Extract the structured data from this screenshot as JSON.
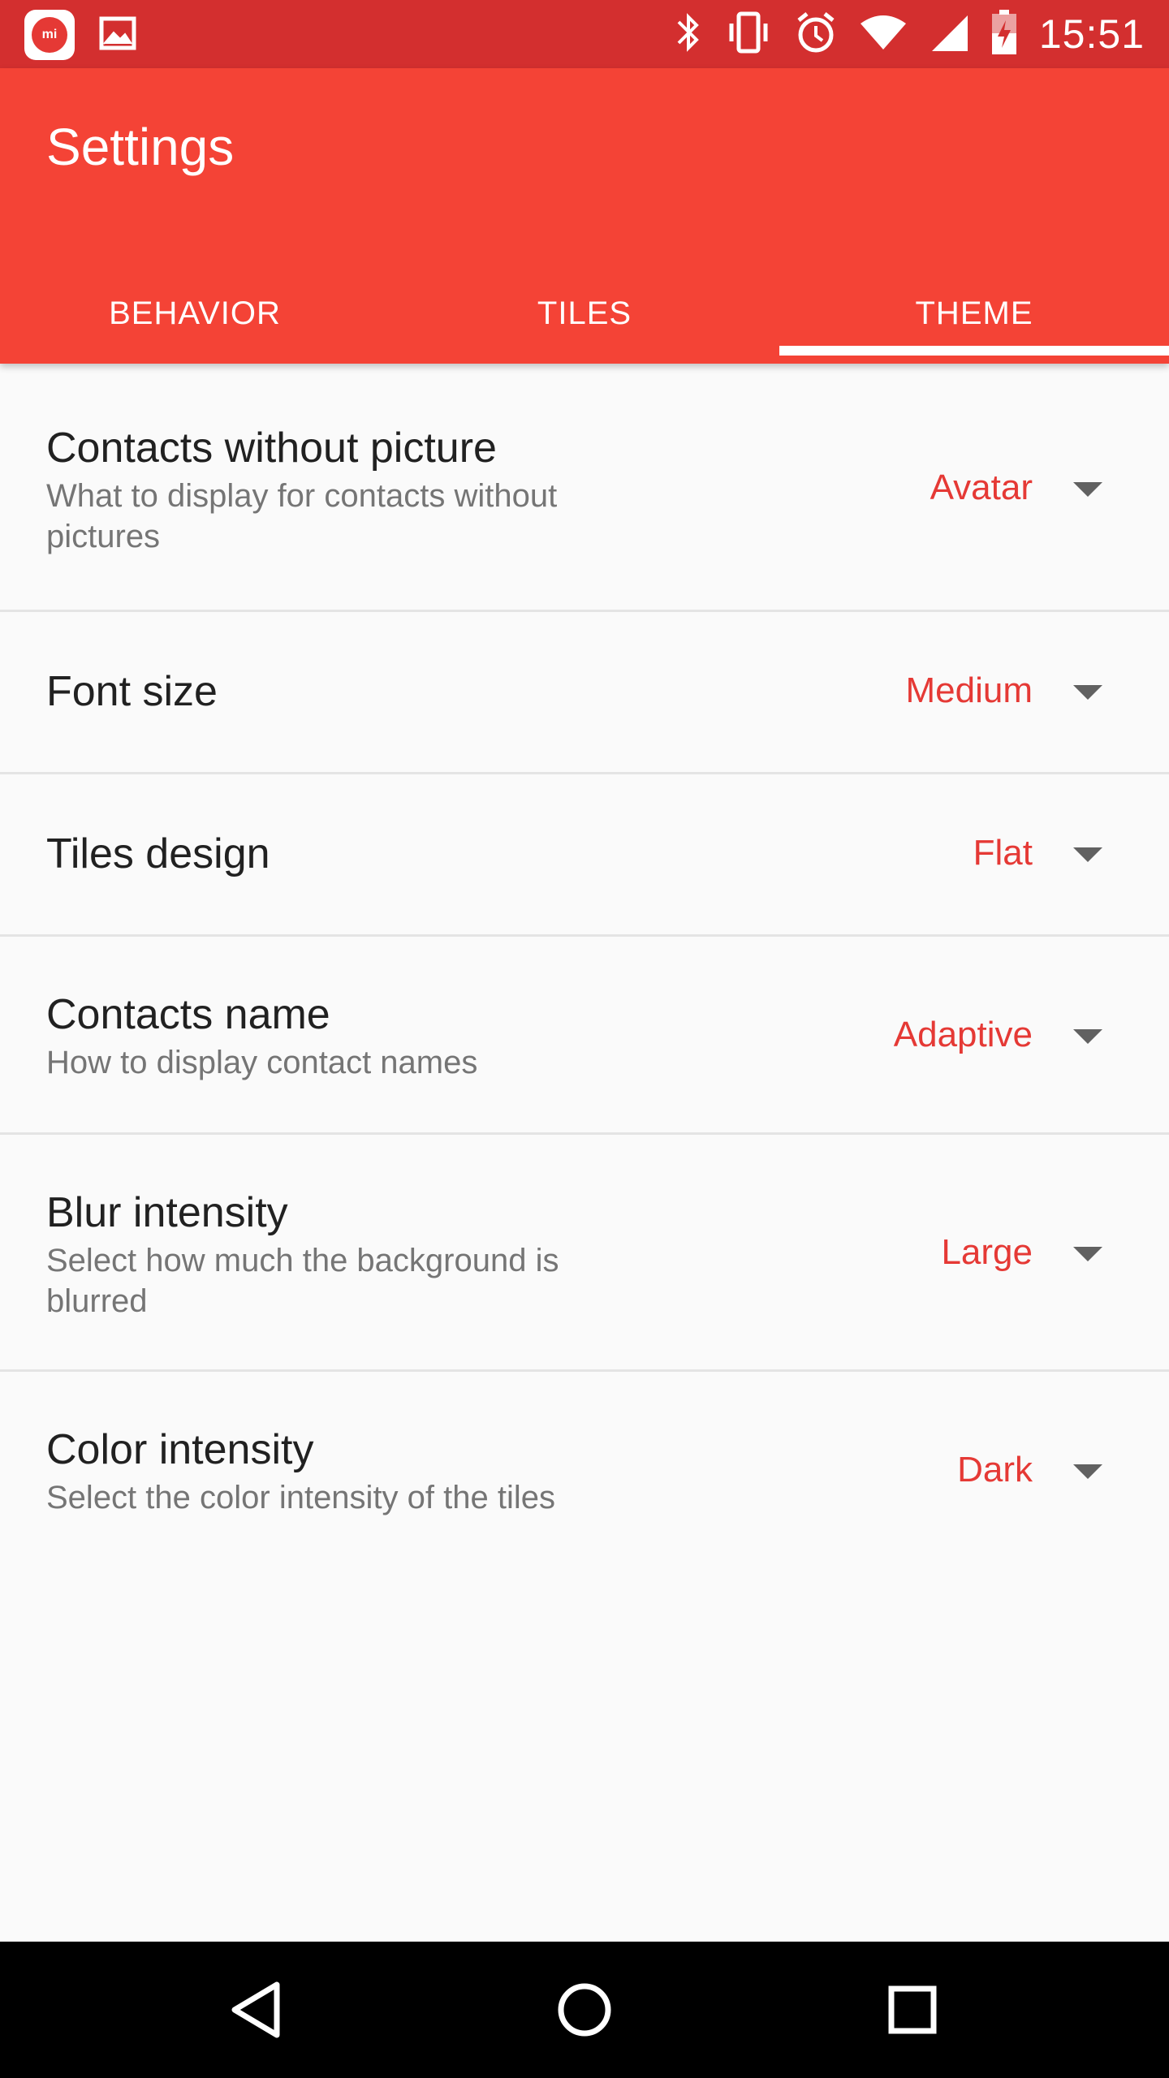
{
  "status_bar": {
    "time": "15:51",
    "icons": [
      "mi-app-icon",
      "image-icon",
      "bluetooth-icon",
      "vibrate-icon",
      "alarm-icon",
      "wifi-icon",
      "cellular-signal-icon",
      "battery-charging-icon"
    ],
    "color": "#d32f2f"
  },
  "appbar": {
    "title": "Settings",
    "color": "#f44336"
  },
  "tabs": [
    {
      "label": "BEHAVIOR",
      "active": false
    },
    {
      "label": "TILES",
      "active": false
    },
    {
      "label": "THEME",
      "active": true
    }
  ],
  "settings": [
    {
      "title": "Contacts without picture",
      "summary": "What to display for contacts without pictures",
      "value": "Avatar"
    },
    {
      "title": "Font size",
      "summary": "",
      "value": "Medium"
    },
    {
      "title": "Tiles design",
      "summary": "",
      "value": "Flat"
    },
    {
      "title": "Contacts name",
      "summary": "How to display contact names",
      "value": "Adaptive"
    },
    {
      "title": "Blur intensity",
      "summary": "Select how much the background is blurred",
      "value": "Large"
    },
    {
      "title": "Color intensity",
      "summary": "Select the color intensity of the tiles",
      "value": "Dark"
    }
  ],
  "accent_color": "#e53935",
  "navbar": {
    "icons": [
      "back-icon",
      "home-icon",
      "recents-icon"
    ]
  }
}
